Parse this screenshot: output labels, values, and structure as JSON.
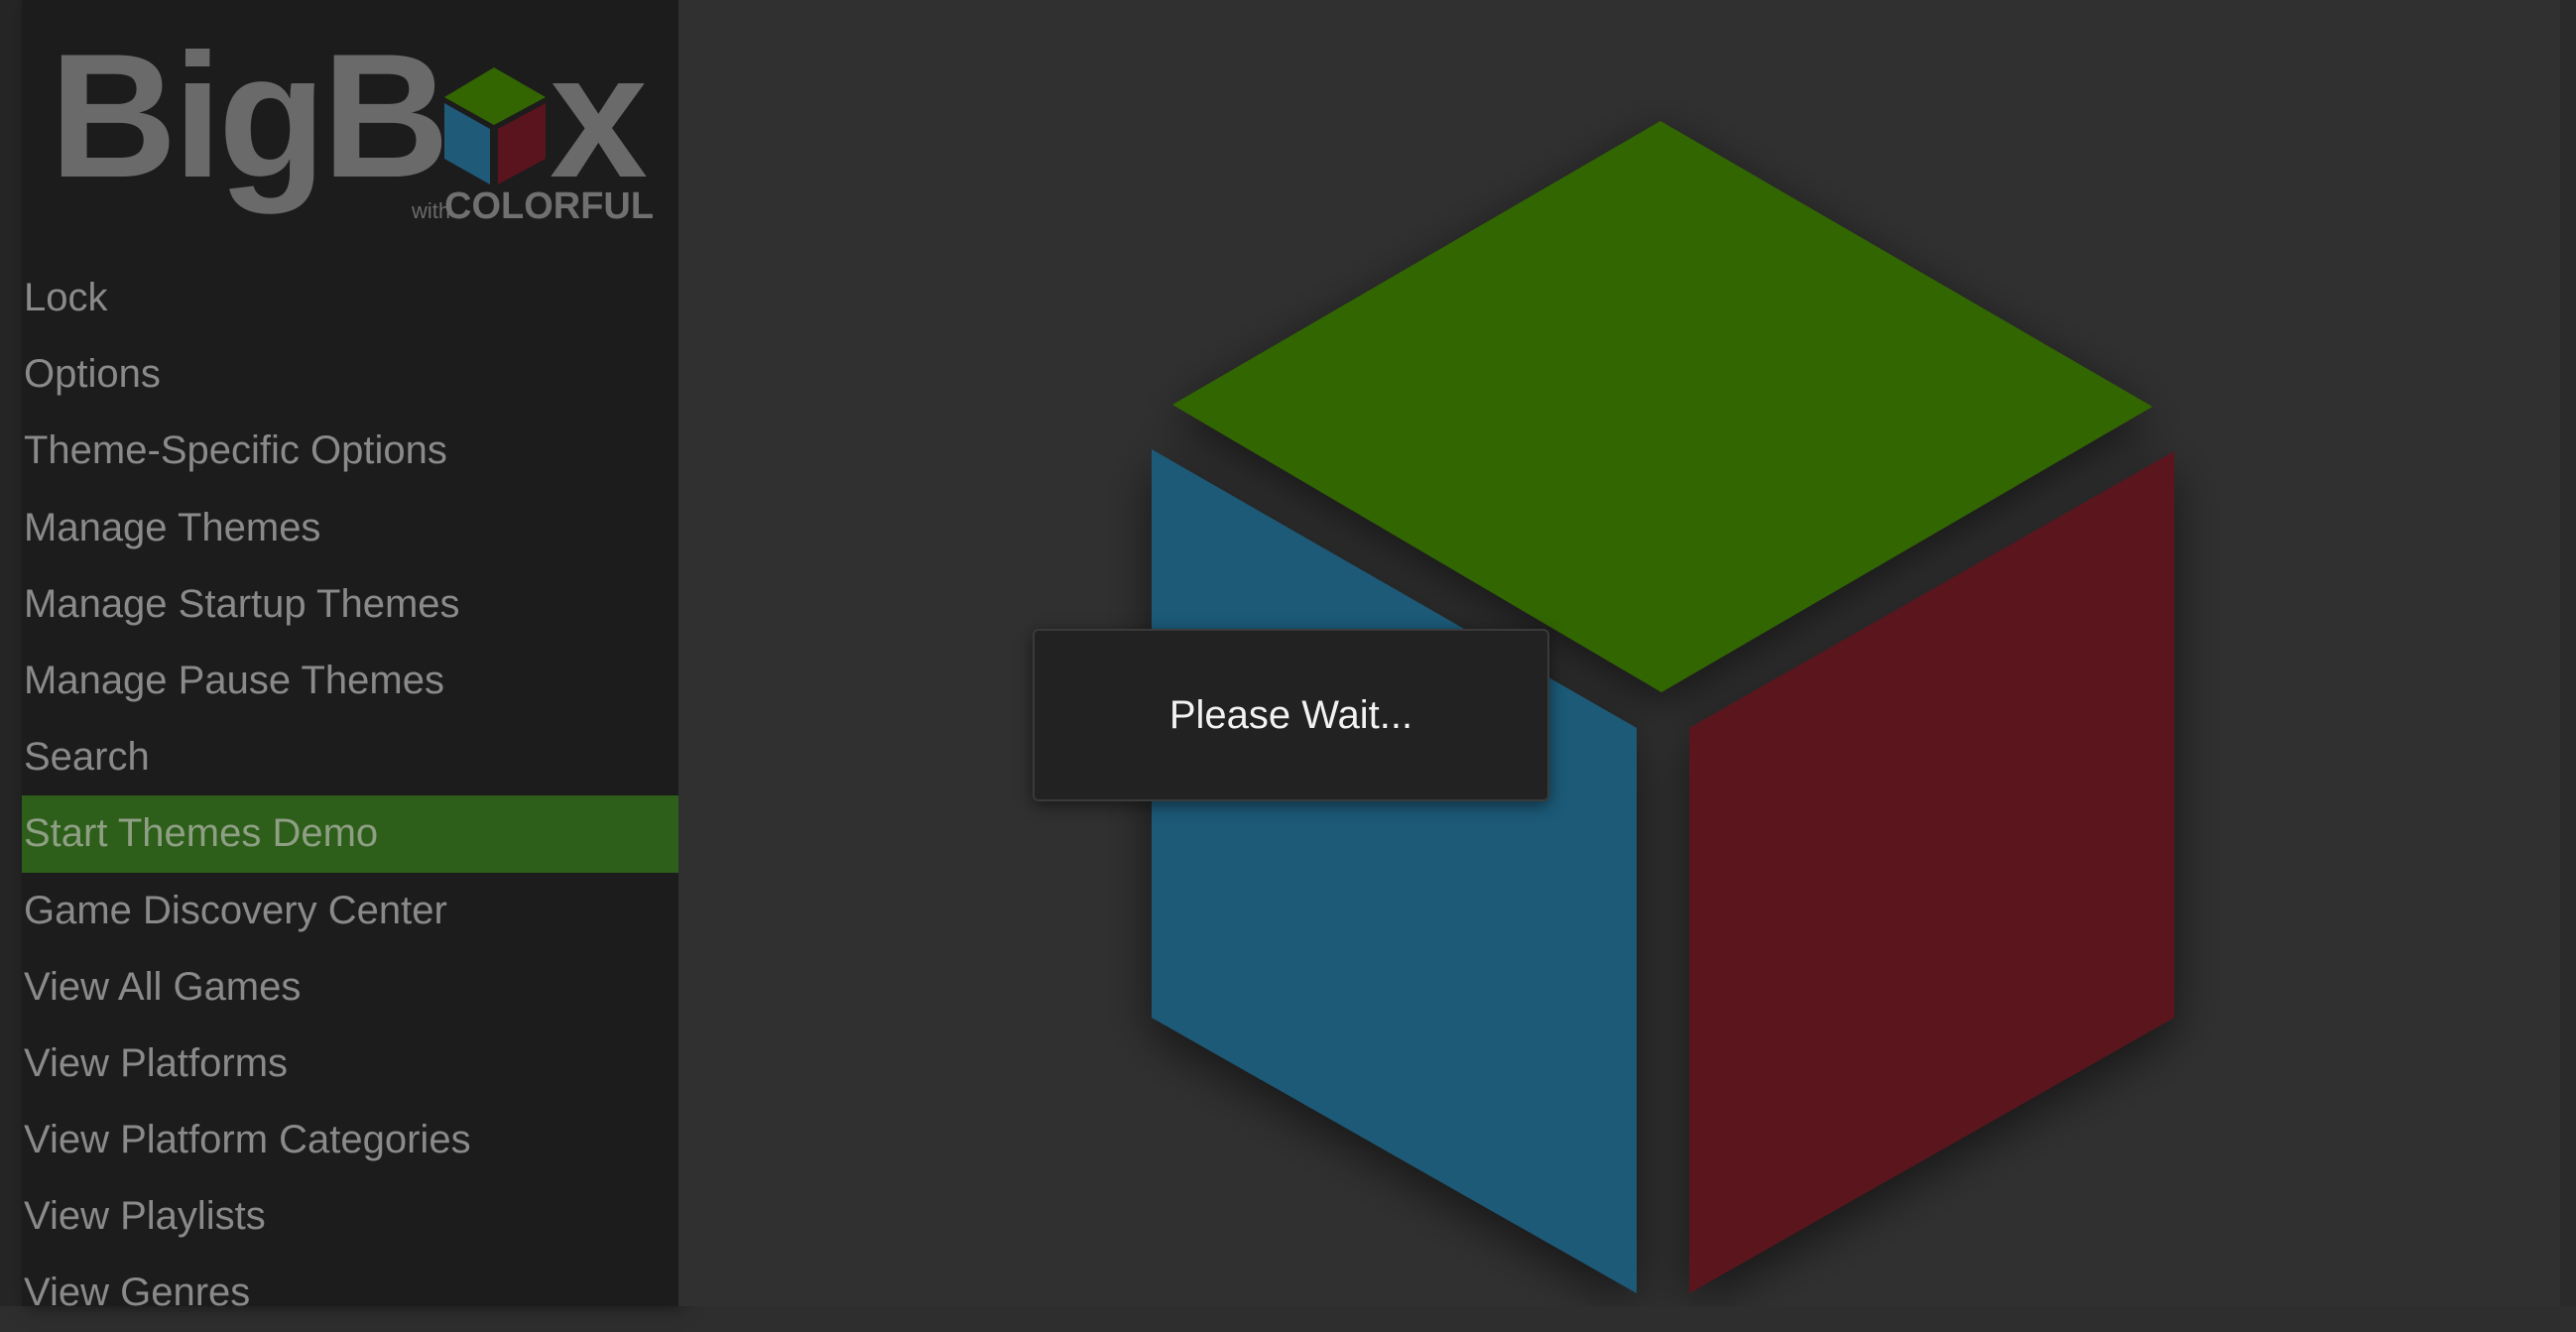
{
  "logo": {
    "brand": "BigBox",
    "with": "with",
    "theme": "COLORFUL"
  },
  "menu": {
    "items": [
      {
        "label": "Lock"
      },
      {
        "label": "Options"
      },
      {
        "label": "Theme-Specific Options"
      },
      {
        "label": "Manage Themes"
      },
      {
        "label": "Manage Startup Themes"
      },
      {
        "label": "Manage Pause Themes"
      },
      {
        "label": "Search"
      },
      {
        "label": "Start Themes Demo",
        "selected": true
      },
      {
        "label": "Game Discovery Center"
      },
      {
        "label": "View All Games"
      },
      {
        "label": "View Platforms"
      },
      {
        "label": "View Platform Categories"
      },
      {
        "label": "View Playlists"
      },
      {
        "label": "View Genres"
      }
    ]
  },
  "dialog": {
    "message": "Please Wait..."
  },
  "colors": {
    "cube_green": "#336600",
    "cube_blue": "#1f5a78",
    "cube_red": "#5a141d",
    "selected_bg": "#2d5e1a"
  }
}
